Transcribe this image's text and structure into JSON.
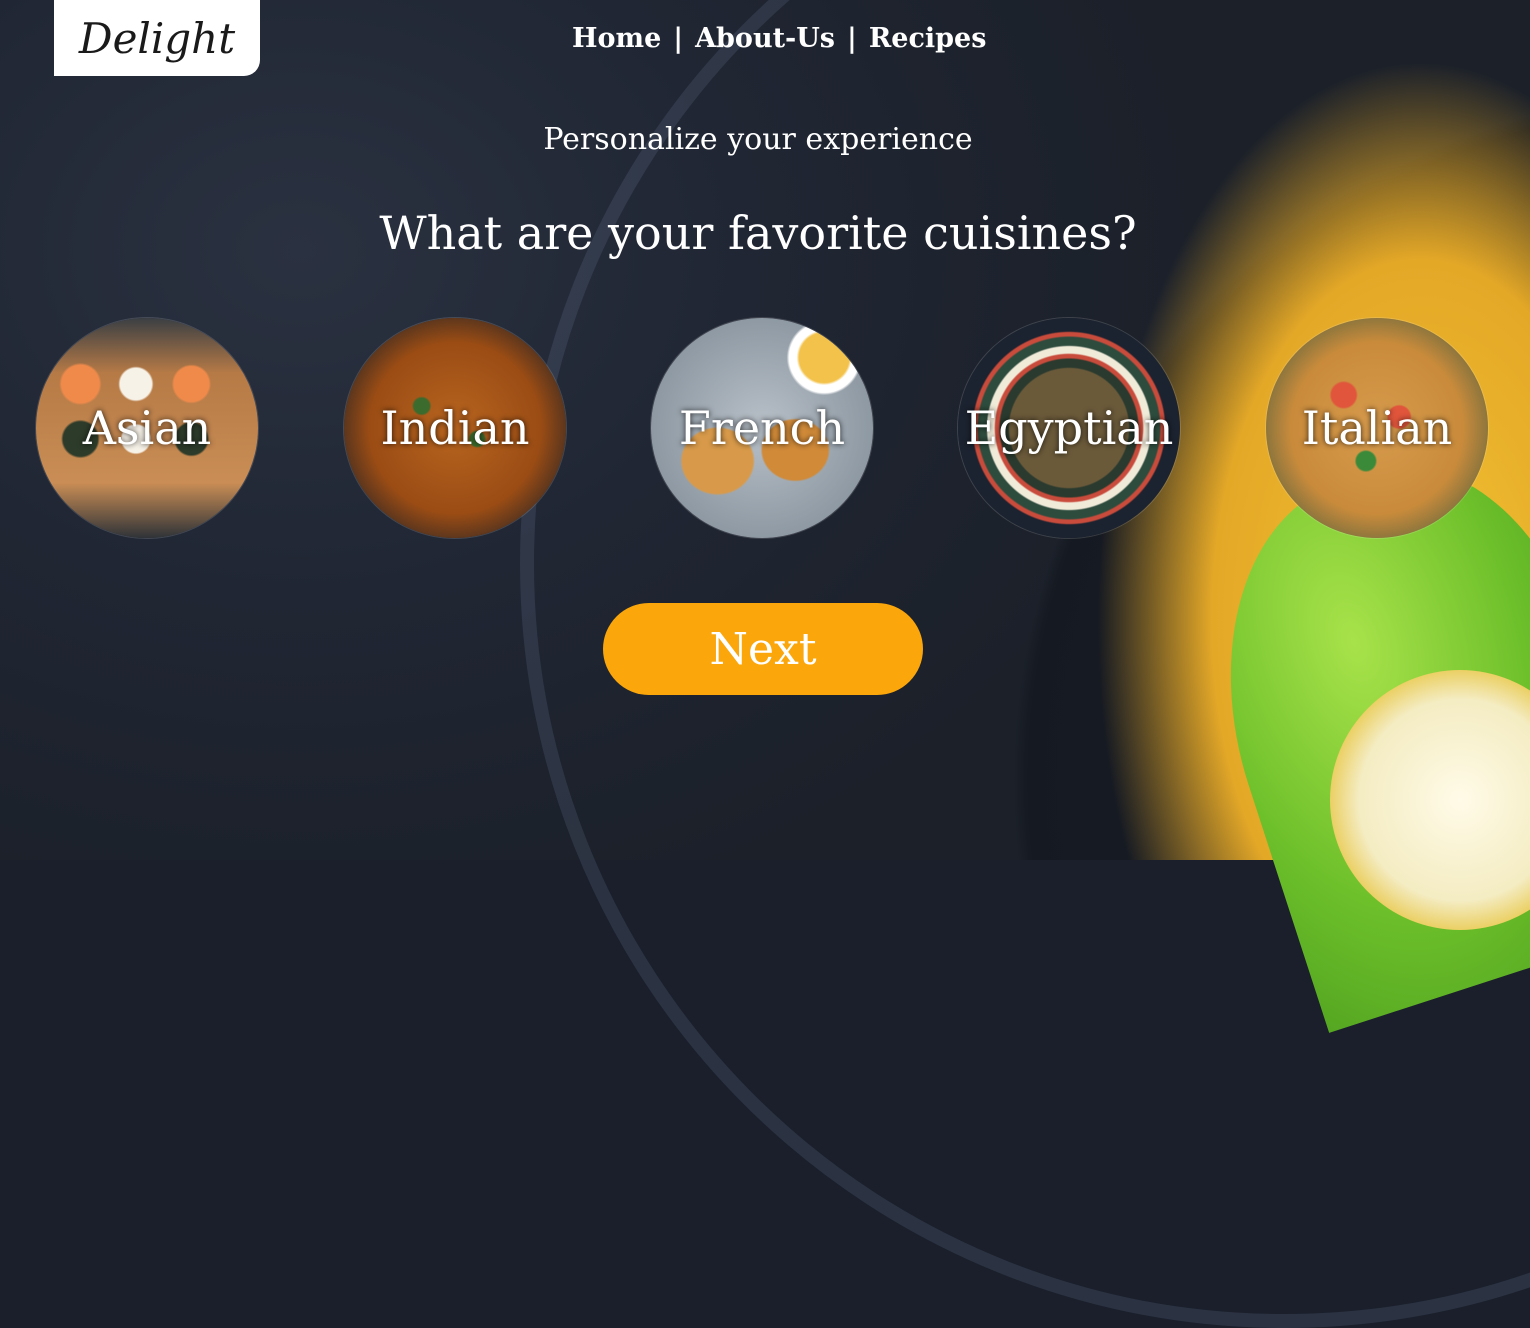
{
  "brand": {
    "logo_text": "Delight"
  },
  "nav": {
    "items": [
      {
        "label": "Home"
      },
      {
        "label": "About-Us"
      },
      {
        "label": "Recipes"
      }
    ],
    "separator": "|"
  },
  "main": {
    "subtitle": "Personalize your experience",
    "question": "What are your favorite cuisines?",
    "cuisines": [
      {
        "label": "Asian"
      },
      {
        "label": "Indian"
      },
      {
        "label": "French"
      },
      {
        "label": "Egyptian"
      },
      {
        "label": "Italian"
      }
    ],
    "next_label": "Next"
  },
  "colors": {
    "accent": "#fba60a",
    "logo_bg": "#ffffff",
    "text": "#ffffff"
  }
}
